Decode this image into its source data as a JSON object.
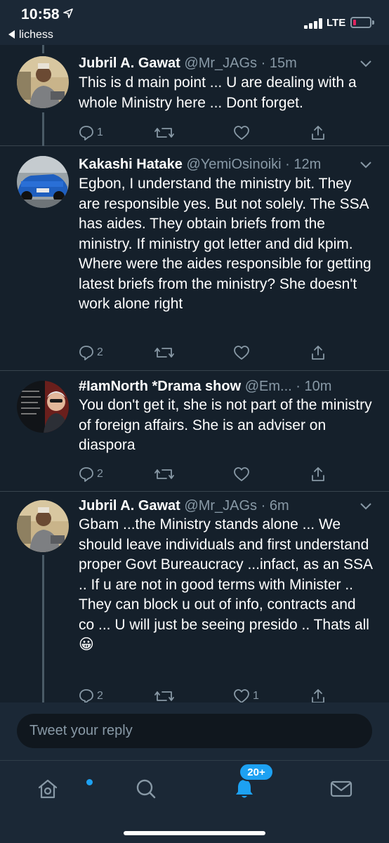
{
  "status_bar": {
    "time": "10:58",
    "back_app": "lichess",
    "network": "LTE"
  },
  "tweets": [
    {
      "name": "Jubril A. Gawat",
      "handle": "@Mr_JAGs",
      "time": "· 15m",
      "text": "This is d main point ... U are dealing with a whole Ministry here ... Dont forget.",
      "replies": "1",
      "retweets": "",
      "likes": ""
    },
    {
      "name": "Kakashi Hatake",
      "handle": "@YemiOsinoiki",
      "time": "· 12m",
      "text": "Egbon, I understand the ministry bit. They are responsible yes. But not solely. The SSA has aides. They obtain briefs from the ministry. If ministry got letter and did kpim. Where were the aides responsible for getting latest briefs from the ministry? She doesn't work alone right",
      "replies": "2",
      "retweets": "",
      "likes": ""
    },
    {
      "name": "#IamNorth *Drama show",
      "handle": "@Em...",
      "time": "· 10m",
      "text": "You don't get it, she is not part of the ministry of foreign affairs. She is an adviser on diaspora",
      "replies": "2",
      "retweets": "",
      "likes": ""
    },
    {
      "name": "Jubril A. Gawat",
      "handle": "@Mr_JAGs",
      "time": "· 6m",
      "text": "Gbam ...the Ministry stands alone ... We should leave individuals and first understand proper Govt Bureaucracy ...infact, as an SSA .. If u are not in good terms with Minister .. They can block u out of info, contracts and co ... U will just be seeing presido .. Thats all 😀",
      "replies": "2",
      "retweets": "",
      "likes": "1"
    }
  ],
  "reply_box": {
    "placeholder": "Tweet your reply"
  },
  "tab_bar": {
    "notifications_badge": "20+"
  },
  "colors": {
    "background": "#15202b",
    "secondary_text": "#8899a6",
    "accent": "#1da1f2",
    "battery_low": "#e0245e"
  }
}
